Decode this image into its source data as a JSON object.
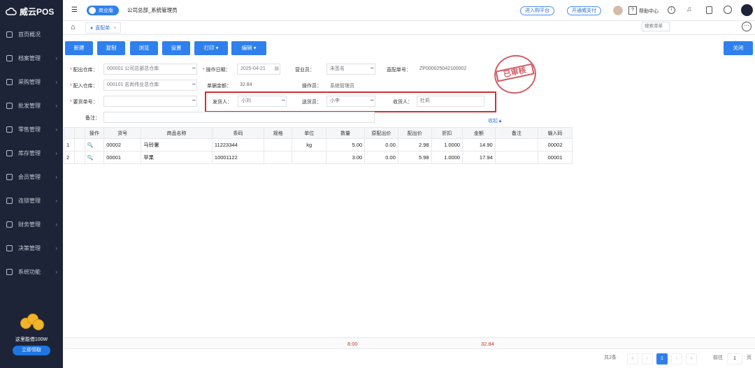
{
  "app": {
    "name": "威云POS"
  },
  "sidebar": {
    "items": [
      {
        "label": "首页概况",
        "icon": "home-icon"
      },
      {
        "label": "档案管理",
        "icon": "folder-icon"
      },
      {
        "label": "采购管理",
        "icon": "cart-icon"
      },
      {
        "label": "批发管理",
        "icon": "store-icon"
      },
      {
        "label": "零售管理",
        "icon": "register-icon"
      },
      {
        "label": "库存管理",
        "icon": "inventory-icon"
      },
      {
        "label": "会员管理",
        "icon": "member-icon"
      },
      {
        "label": "连锁管理",
        "icon": "chain-icon"
      },
      {
        "label": "财务管理",
        "icon": "finance-icon"
      },
      {
        "label": "决策管理",
        "icon": "chart-icon"
      },
      {
        "label": "系统功能",
        "icon": "settings-icon"
      }
    ]
  },
  "promo": {
    "text": "这里能借100W",
    "button": "立即领取"
  },
  "header": {
    "edition": "商业版",
    "company": "公司总部_系统管理员",
    "btn_purchase": "进入购平台",
    "btn_pay": "开通威支付",
    "help": "帮助中心"
  },
  "tabs": {
    "active": "直配单"
  },
  "search_menu": "搜索菜单",
  "toolbar": {
    "new": "新建",
    "copy": "复制",
    "browse": "浏览",
    "settings": "设置",
    "print": "打印",
    "edit": "编辑",
    "close": "关闭"
  },
  "stamp": "已审核",
  "form": {
    "out_wh_label": "配出仓库：",
    "out_wh_value": "000001 公司总部总仓库",
    "op_date_label": "操作日期：",
    "op_date_value": "2025-04-21",
    "salesman_label": "营业员：",
    "salesman_value": "未签名",
    "order_no_label": "直配单号：",
    "order_no_value": "ZP000025042100002",
    "in_wh_label": "配入仓库：",
    "in_wh_value": "000101 志尚伟业总仓库",
    "amount_label": "单据金额：",
    "amount_value": "32.84",
    "operator_label": "操作员：",
    "operator_value": "系统管理员",
    "request_label": "要货单号：",
    "shipper_label": "发货人：",
    "shipper_value": "小刘",
    "deliverer_label": "送货员：",
    "deliverer_value": "小李",
    "receiver_label": "收货人：",
    "receiver_value": "杜莉",
    "note_label": "备注：",
    "collapse": "收起▲"
  },
  "table": {
    "headers": [
      "",
      "",
      "操作",
      "货号",
      "商品名称",
      "条码",
      "规格",
      "单位",
      "数量",
      "原配出价",
      "配出价",
      "折扣",
      "金额",
      "备注",
      "输入码"
    ],
    "rows": [
      [
        "1",
        "",
        "",
        "00002",
        "马铃薯",
        "11223344",
        "",
        "kg",
        "5.00",
        "0.00",
        "2.98",
        "1.0000",
        "14.90",
        "",
        "00002"
      ],
      [
        "2",
        "",
        "",
        "00001",
        "苹果",
        "10001122",
        "",
        "",
        "3.00",
        "0.00",
        "5.98",
        "1.0000",
        "17.94",
        "",
        "00001"
      ]
    ],
    "total_qty": "8.00",
    "total_amount": "32.84"
  },
  "pager": {
    "total": "共2条",
    "current": "1",
    "goto_label": "前往",
    "goto_value": "1",
    "page_unit": "页"
  }
}
